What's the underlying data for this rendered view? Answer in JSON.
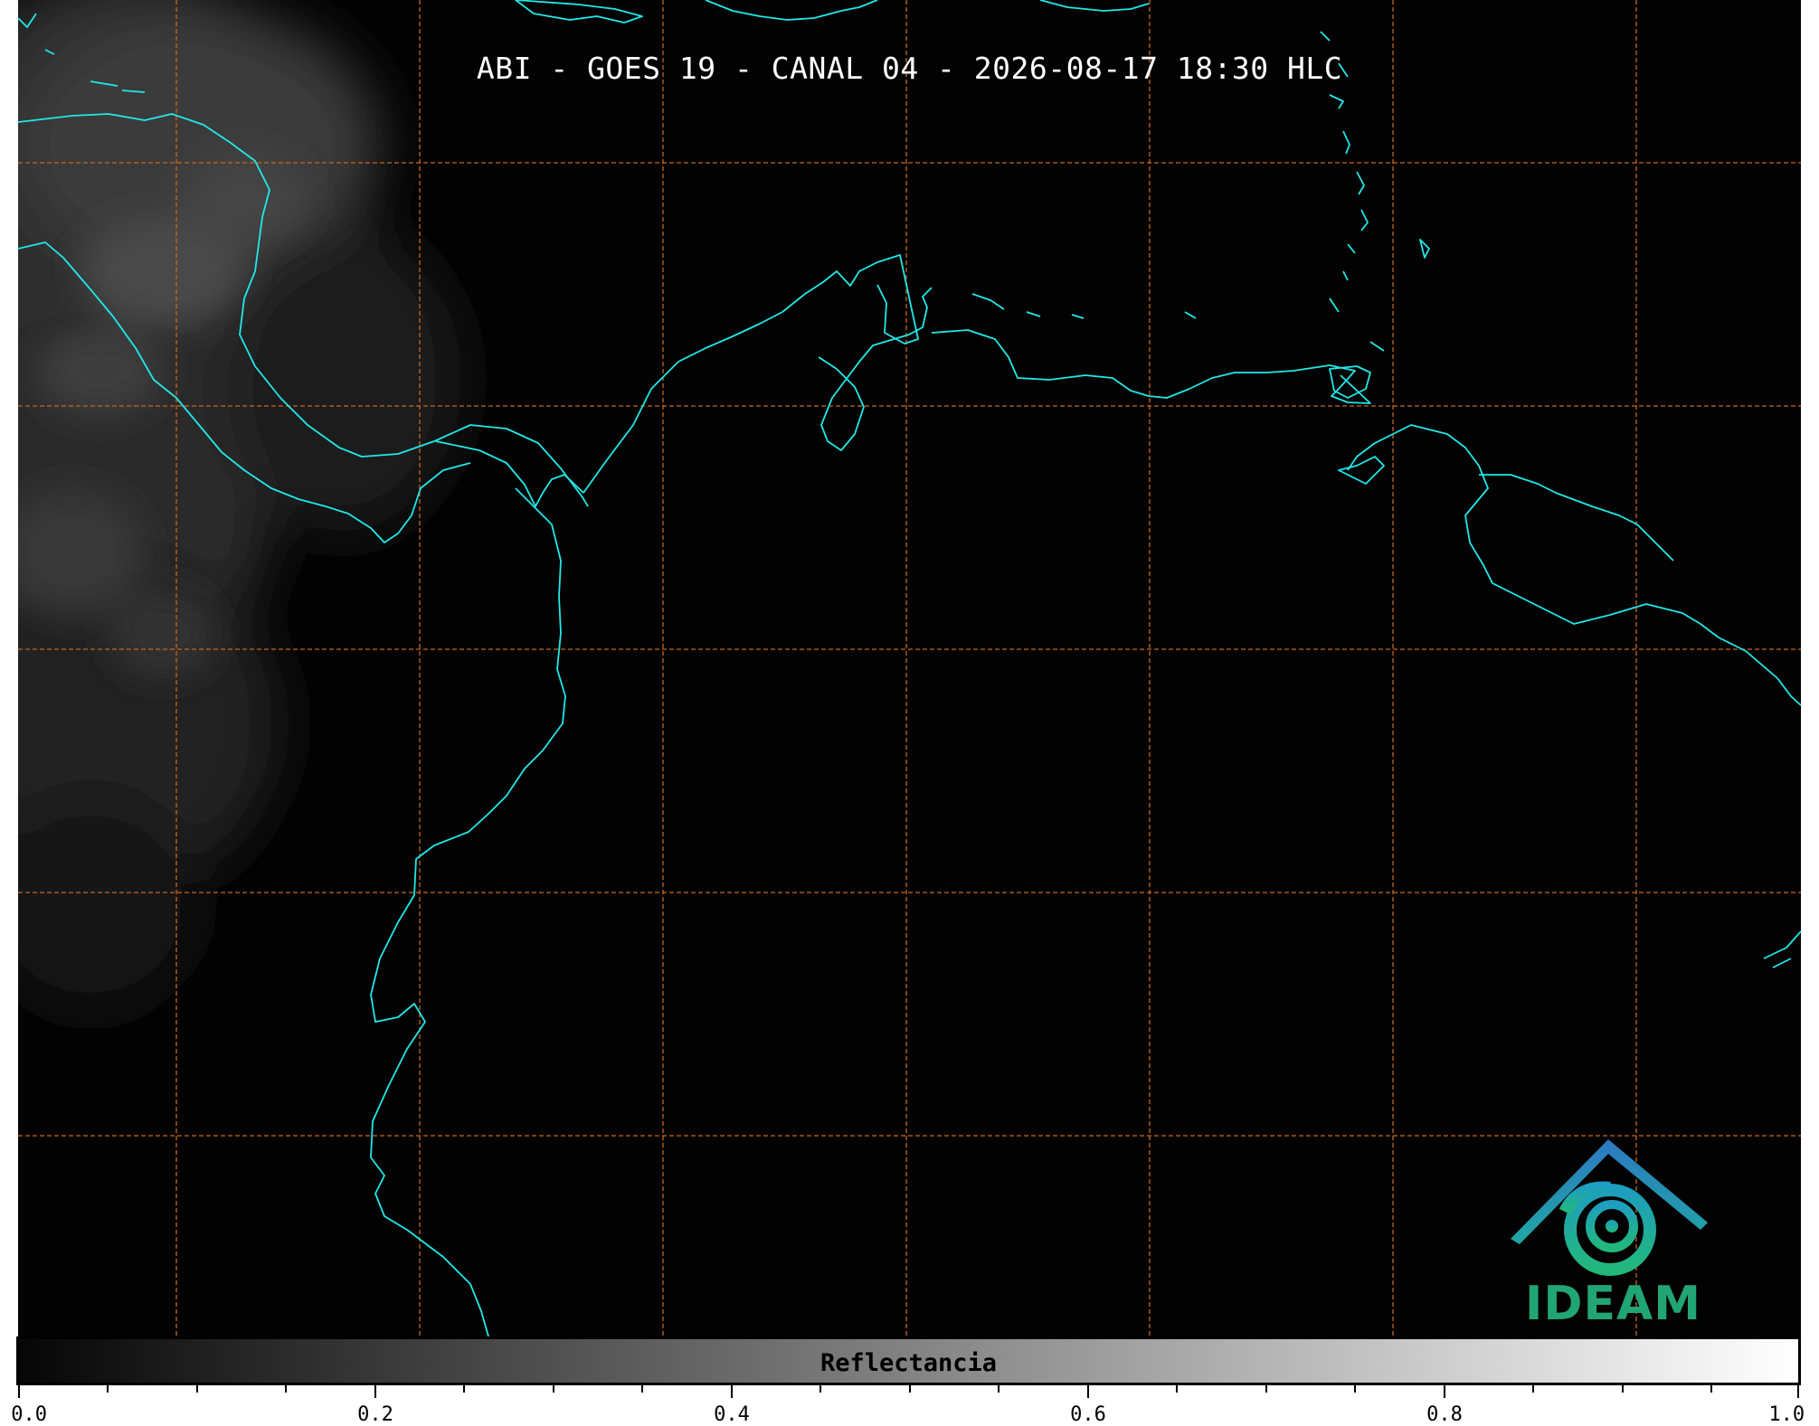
{
  "title": "ABI - GOES 19 - CANAL 04 - 2026-08-17 18:30 HLC",
  "colorbar": {
    "label": "Reflectancia",
    "ticks": [
      "0.0",
      "0.2",
      "0.4",
      "0.6",
      "0.8",
      "1.0"
    ],
    "range": [
      0.0,
      1.0
    ],
    "colormap_from": "#060606",
    "colormap_to": "#ffffff"
  },
  "logo": {
    "text": "IDEAM"
  },
  "colors": {
    "coastline": "#22e8e8",
    "graticule": "#c8661e",
    "background": "#020202"
  }
}
